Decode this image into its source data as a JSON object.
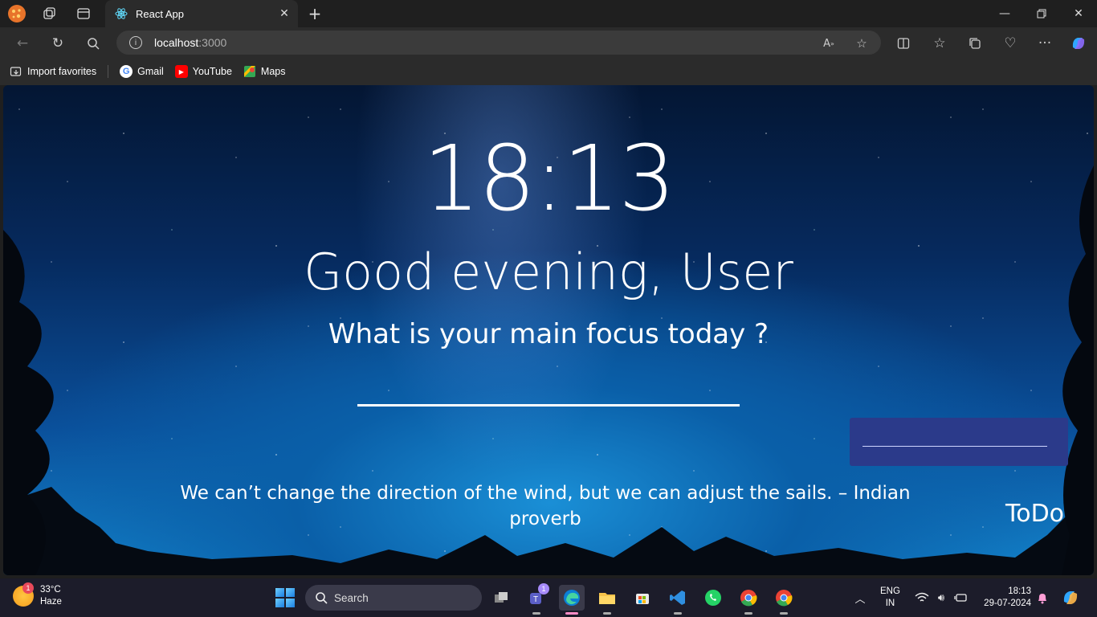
{
  "browser": {
    "tab_title": "React App",
    "url_host": "localhost",
    "url_port": ":3000",
    "bookmarks": [
      {
        "label": "Import favorites",
        "icon": "import-icon"
      },
      {
        "label": "Gmail",
        "icon": "gmail-icon"
      },
      {
        "label": "YouTube",
        "icon": "youtube-icon"
      },
      {
        "label": "Maps",
        "icon": "maps-icon"
      }
    ]
  },
  "app": {
    "clock": "18:13",
    "greeting": "Good evening, User",
    "focus_question": "What is your main focus today ?",
    "focus_value": "",
    "todo_input_value": "",
    "quote": "We can’t change the direction of the wind, but we can adjust the sails. – Indian proverb",
    "todo_label": "ToDo"
  },
  "taskbar": {
    "weather_temp": "33°C",
    "weather_desc": "Haze",
    "weather_badge": "1",
    "search_label": "Search",
    "teams_badge": "1",
    "lang_line1": "ENG",
    "lang_line2": "IN",
    "time": "18:13",
    "date": "29-07-2024"
  },
  "colors": {
    "accent_todo_panel": "#2b3a8a",
    "taskbar_bg": "#1c1c2a",
    "browser_bg": "#1f1f1f"
  }
}
